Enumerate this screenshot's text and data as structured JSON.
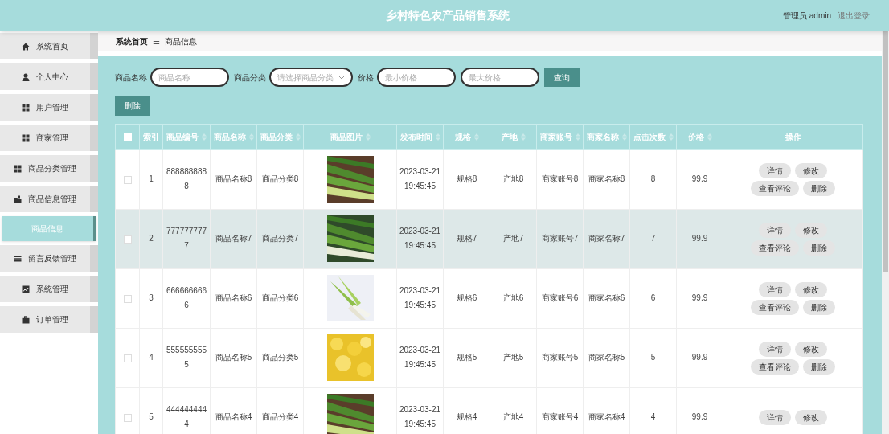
{
  "header": {
    "title": "乡村特色农产品销售系统",
    "user": "管理员 admin",
    "logout": "退出登录"
  },
  "sidebar": {
    "items": [
      {
        "label": "系统首页",
        "selected": false,
        "kind": "menu"
      },
      {
        "label": "个人中心",
        "selected": false,
        "kind": "menu"
      },
      {
        "label": "用户管理",
        "selected": false,
        "kind": "menu"
      },
      {
        "label": "商家管理",
        "selected": false,
        "kind": "menu"
      },
      {
        "label": "商品分类管理",
        "selected": false,
        "kind": "menu"
      },
      {
        "label": "商品信息管理",
        "selected": false,
        "kind": "menu"
      },
      {
        "label": "商品信息",
        "selected": true,
        "kind": "sub"
      },
      {
        "label": "留言反馈管理",
        "selected": false,
        "kind": "menu"
      },
      {
        "label": "系统管理",
        "selected": false,
        "kind": "menu"
      },
      {
        "label": "订单管理",
        "selected": false,
        "kind": "menu"
      }
    ]
  },
  "breadcrumb": {
    "home": "系统首页",
    "separator": "☰",
    "current": "商品信息"
  },
  "filters": {
    "name_label": "商品名称",
    "name_placeholder": "商品名称",
    "category_label": "商品分类",
    "category_placeholder": "请选择商品分类",
    "price_label": "价格",
    "min_placeholder": "最小价格",
    "max_placeholder": "最大价格",
    "search_button": "查询"
  },
  "delete_button": "删除",
  "table": {
    "select_all": {
      "checked": false
    },
    "columns": [
      {
        "label": "索引",
        "sortable": false,
        "kind": "text"
      },
      {
        "label": "商品编号",
        "sortable": true,
        "kind": "text"
      },
      {
        "label": "商品名称",
        "sortable": true,
        "kind": "text"
      },
      {
        "label": "商品分类",
        "sortable": true,
        "kind": "text"
      },
      {
        "label": "商品图片",
        "sortable": true
      },
      {
        "label": "发布时间",
        "sortable": true,
        "kind": "text"
      },
      {
        "label": "规格",
        "sortable": true,
        "kind": "text"
      },
      {
        "label": "产地",
        "sortable": true,
        "kind": "text"
      },
      {
        "label": "商家账号",
        "sortable": true,
        "kind": "text"
      },
      {
        "label": "商家名称",
        "sortable": true,
        "kind": "text"
      },
      {
        "label": "点击次数",
        "sortable": true,
        "kind": "text"
      },
      {
        "label": "价格",
        "sortable": true,
        "kind": "text"
      },
      {
        "label": "操作",
        "sortable": false,
        "kind": "actions"
      }
    ],
    "rows": [
      {
        "selected": false,
        "checked": false,
        "index": "1",
        "code": "8888888888",
        "name": "商品名称8",
        "category": "商品分类8",
        "time": "2023-03-21 19:45:45",
        "spec": "规格8",
        "origin": "产地8",
        "merchant_account": "商家账号8",
        "merchant_name": "商家名称8",
        "clicks": "8",
        "price": "99.9",
        "actions": [
          "详情",
          "修改",
          "查看评论",
          "删除"
        ]
      },
      {
        "selected": true,
        "checked": false,
        "index": "2",
        "code": "7777777777",
        "name": "商品名称7",
        "category": "商品分类7",
        "time": "2023-03-21 19:45:45",
        "spec": "规格7",
        "origin": "产地7",
        "merchant_account": "商家账号7",
        "merchant_name": "商家名称7",
        "clicks": "7",
        "price": "99.9",
        "actions": [
          "详情",
          "修改",
          "查看评论",
          "删除"
        ]
      },
      {
        "selected": false,
        "checked": false,
        "index": "3",
        "code": "6666666666",
        "name": "商品名称6",
        "category": "商品分类6",
        "time": "2023-03-21 19:45:45",
        "spec": "规格6",
        "origin": "产地6",
        "merchant_account": "商家账号6",
        "merchant_name": "商家名称6",
        "clicks": "6",
        "price": "99.9",
        "actions": [
          "详情",
          "修改",
          "查看评论",
          "删除"
        ]
      },
      {
        "selected": false,
        "checked": false,
        "index": "4",
        "code": "5555555555",
        "name": "商品名称5",
        "category": "商品分类5",
        "time": "2023-03-21 19:45:45",
        "spec": "规格5",
        "origin": "产地5",
        "merchant_account": "商家账号5",
        "merchant_name": "商家名称5",
        "clicks": "5",
        "price": "99.9",
        "actions": [
          "详情",
          "修改",
          "查看评论",
          "删除"
        ]
      },
      {
        "selected": false,
        "checked": false,
        "index": "5",
        "code": "4444444444",
        "name": "商品名称4",
        "category": "商品分类4",
        "time": "2023-03-21 19:45:45",
        "spec": "规格4",
        "origin": "产地4",
        "merchant_account": "商家账号4",
        "merchant_name": "商家名称4",
        "clicks": "4",
        "price": "99.9",
        "actions": [
          "详情",
          "修改"
        ]
      }
    ]
  }
}
